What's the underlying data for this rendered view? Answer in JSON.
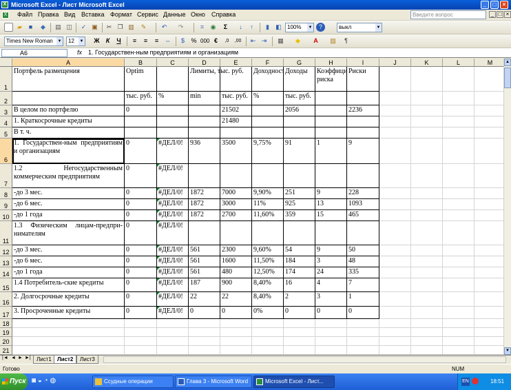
{
  "window": {
    "title": "Microsoft Excel - Лист Microsoft Excel"
  },
  "menu": {
    "items": [
      "Файл",
      "Правка",
      "Вид",
      "Вставка",
      "Формат",
      "Сервис",
      "Данные",
      "Окно",
      "Справка"
    ],
    "help_placeholder": "Введите вопрос"
  },
  "toolbar": {
    "zoom": "100%",
    "style_box": "выкл",
    "font_name": "Times New Roman",
    "font_size": "12",
    "bold": "Ж",
    "italic": "К",
    "underline": "Ч",
    "percent": "%",
    "thousands": "000",
    "currency": "€",
    "sum": "Σ"
  },
  "formula_bar": {
    "cell_ref": "A6",
    "fx": "fx",
    "value": "1. Государствен-ным предприятиям и организациям"
  },
  "columns": [
    "A",
    "B",
    "C",
    "D",
    "E",
    "F",
    "G",
    "H",
    "I",
    "J",
    "K",
    "L",
    "M"
  ],
  "rows": [
    "1",
    "2",
    "3",
    "4",
    "5",
    "6",
    "7",
    "8",
    "9",
    "10",
    "11",
    "12",
    "13",
    "14",
    "15",
    "16",
    "17",
    "18",
    "19",
    "20",
    "21"
  ],
  "cells": {
    "r1": {
      "a": "Портфель размещения",
      "b": "Optim",
      "d": "Лимиты, тыс. руб.",
      "f": "Доходность",
      "g": "Доходы",
      "h": "Коэффициент риска",
      "i": "Риски"
    },
    "r2": {
      "b": "тыс. руб.",
      "c": "%",
      "d": "min",
      "e": "тыс. руб.",
      "f": "%",
      "g": "тыс. руб."
    },
    "r3": {
      "a": "В целом по портфелю",
      "b": "0",
      "e": "21502",
      "g": "2056",
      "i": "2236"
    },
    "r4": {
      "a": "1. Краткосрочные кредиты",
      "e": "21480"
    },
    "r5": {
      "a": "В т. ч."
    },
    "r6": {
      "a": "1. Государствен-ным предприятиям и организациям",
      "b": "0",
      "c": "#ДЕЛ/0!",
      "d": "936",
      "e": "3500",
      "f": "9,75%",
      "g": "91",
      "h": "1",
      "i": "9"
    },
    "r7": {
      "a": "1.2 Негосударственным коммерческим предприятиям",
      "b": "0",
      "c": "#ДЕЛ/0!"
    },
    "r8": {
      "a": "-до 3 мес.",
      "b": "0",
      "c": "#ДЕЛ/0!",
      "d": "1872",
      "e": "7000",
      "f": "9,90%",
      "g": "251",
      "h": "9",
      "i": "228"
    },
    "r9": {
      "a": "-до 6 мес.",
      "b": "0",
      "c": "#ДЕЛ/0!",
      "d": "1872",
      "e": "3000",
      "f": "11%",
      "g": "925",
      "h": "13",
      "i": "1093"
    },
    "r10": {
      "a": "-до 1 года",
      "b": "0",
      "c": "#ДЕЛ/0!",
      "d": "1872",
      "e": "2700",
      "f": "11,60%",
      "g": "359",
      "h": "15",
      "i": "465"
    },
    "r11": {
      "a": "1.3 Физическим лицам-предпри-нимателям",
      "b": "0",
      "c": "#ДЕЛ/0!"
    },
    "r12": {
      "a": "-до 3 мес.",
      "b": "0",
      "c": "#ДЕЛ/0!",
      "d": "561",
      "e": "2300",
      "f": "9,60%",
      "g": "54",
      "h": "9",
      "i": "50"
    },
    "r13": {
      "a": "-до 6 мес.",
      "b": "0",
      "c": "#ДЕЛ/0!",
      "d": "561",
      "e": "1600",
      "f": "11,50%",
      "g": "184",
      "h": "3",
      "i": "48"
    },
    "r14": {
      "a": "-до 1 года",
      "b": "0",
      "c": "#ДЕЛ/0!",
      "d": "561",
      "e": "480",
      "f": "12,50%",
      "g": "174",
      "h": "24",
      "i": "335"
    },
    "r15": {
      "a": "1.4 Потребитель-ские кредиты",
      "b": "0",
      "c": "#ДЕЛ/0!",
      "d": "187",
      "e": "900",
      "f": "8,40%",
      "g": "16",
      "h": "4",
      "i": "7"
    },
    "r16": {
      "a": "2. Долгосрочные кредиты",
      "b": "0",
      "c": "#ДЕЛ/0!",
      "d": "22",
      "e": "22",
      "f": "8,40%",
      "g": "2",
      "h": "3",
      "i": "1"
    },
    "r17": {
      "a": "3. Просроченные кредиты",
      "b": "0",
      "c": "#ДЕЛ/0!",
      "d": "0",
      "e": "0",
      "f": "0%",
      "g": "0",
      "h": "0",
      "i": "0"
    }
  },
  "sheets": [
    "Лист1",
    "Лист2",
    "Лист3"
  ],
  "status": {
    "left": "Готово",
    "right": "NUM"
  },
  "taskbar": {
    "start": "Пуск",
    "tasks": [
      "Ссудные операции",
      "Глава 3 - Microsoft Word",
      "Microsoft Excel - Лист..."
    ],
    "lang": "EN",
    "clock": "18:51"
  }
}
